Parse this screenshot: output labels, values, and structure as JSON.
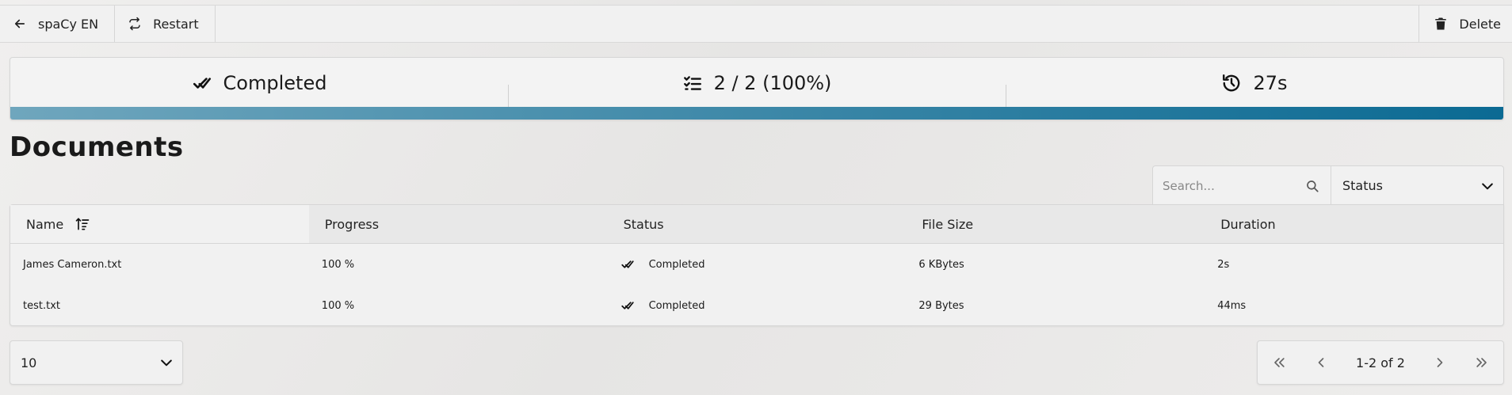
{
  "toolbar": {
    "back_label": "spaCy EN",
    "restart_label": "Restart",
    "delete_label": "Delete"
  },
  "status": {
    "state": "Completed",
    "progress_text": "2 / 2 (100%)",
    "progress_fraction": 1.0,
    "elapsed": "27s",
    "bar_colors": [
      "#6fa6bd",
      "#0b6a93"
    ]
  },
  "documents": {
    "title": "Documents",
    "search_placeholder": "Search...",
    "status_filter": "Status",
    "columns": [
      "Name",
      "Progress",
      "Status",
      "File Size",
      "Duration"
    ],
    "rows": [
      {
        "name": "James Cameron.txt",
        "progress": "100 %",
        "status": "Completed",
        "size": "6 KBytes",
        "duration": "2s"
      },
      {
        "name": "test.txt",
        "progress": "100 %",
        "status": "Completed",
        "size": "29 Bytes",
        "duration": "44ms"
      }
    ]
  },
  "pagination": {
    "page_size": "10",
    "range": "1-2 of 2"
  }
}
